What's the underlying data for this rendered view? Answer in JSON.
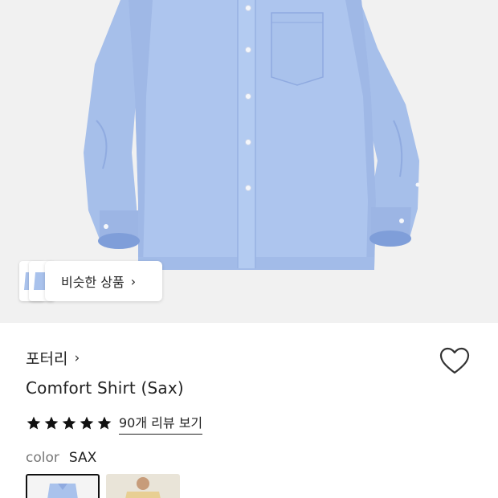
{
  "product": {
    "image_alt": "light blue long-sleeve shirt",
    "similar_button_label": "비슷한 상품",
    "brand": "포터리",
    "name": "Comfort Shirt (Sax)",
    "rating_stars": 5,
    "reviews_link": "90개 리뷰 보기",
    "color_label": "color",
    "color_value": "SAX",
    "swatches": [
      {
        "name": "SAX",
        "selected": true,
        "color": "#a9c2ec"
      },
      {
        "name": "beige",
        "selected": false,
        "color": "#e8cf93"
      }
    ]
  },
  "colors": {
    "shirt": "#a9c2ec",
    "shirt_shadow": "#8eaadf",
    "hero_bg": "#f1f1f1",
    "text": "#222222",
    "muted": "#777777"
  },
  "icons": {
    "heart": "heart-outline-icon",
    "chevron": "chevron-right-icon",
    "star": "star-filled-icon"
  }
}
